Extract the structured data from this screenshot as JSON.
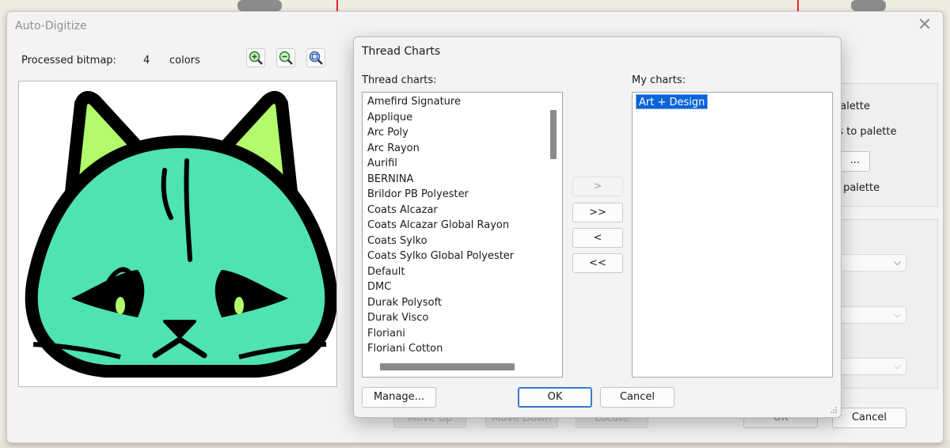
{
  "main_window": {
    "title": "Auto-Digitize",
    "processed_label": "Processed bitmap:",
    "processed_count": "4",
    "processed_unit": "colors",
    "right_panel": {
      "option1": "palette",
      "option2": "rs to palette",
      "option3_button": "...",
      "option4": "o palette"
    },
    "ghost_buttons": [
      "Move Up",
      "Move Down",
      "Locate"
    ],
    "ok_label": "OK",
    "cancel_label": "Cancel"
  },
  "dialog": {
    "title": "Thread Charts",
    "thread_charts_label": "Thread charts:",
    "my_charts_label": "My charts:",
    "thread_charts": [
      "Amefird Signature",
      "Applique",
      "Arc Poly",
      "Arc Rayon",
      "Aurifil",
      "BERNINA",
      "Brildor PB Polyester",
      "Coats Alcazar",
      "Coats Alcazar Global Rayon",
      "Coats Sylko",
      "Coats Sylko Global Polyester",
      "Default",
      "DMC",
      "Durak Polysoft",
      "Durak Visco",
      "Floriani",
      "Floriani Cotton"
    ],
    "my_charts": [
      "Art + Design"
    ],
    "add_label": ">",
    "add_all_label": ">>",
    "remove_label": "<",
    "remove_all_label": "<<",
    "manage_label": "Manage...",
    "ok_label": "OK",
    "cancel_label": "Cancel"
  },
  "colors": {
    "cat_body": "#4ee3b0",
    "cat_ears": "#b3fb6b",
    "outline": "#000000",
    "selection": "#0a64d8"
  }
}
